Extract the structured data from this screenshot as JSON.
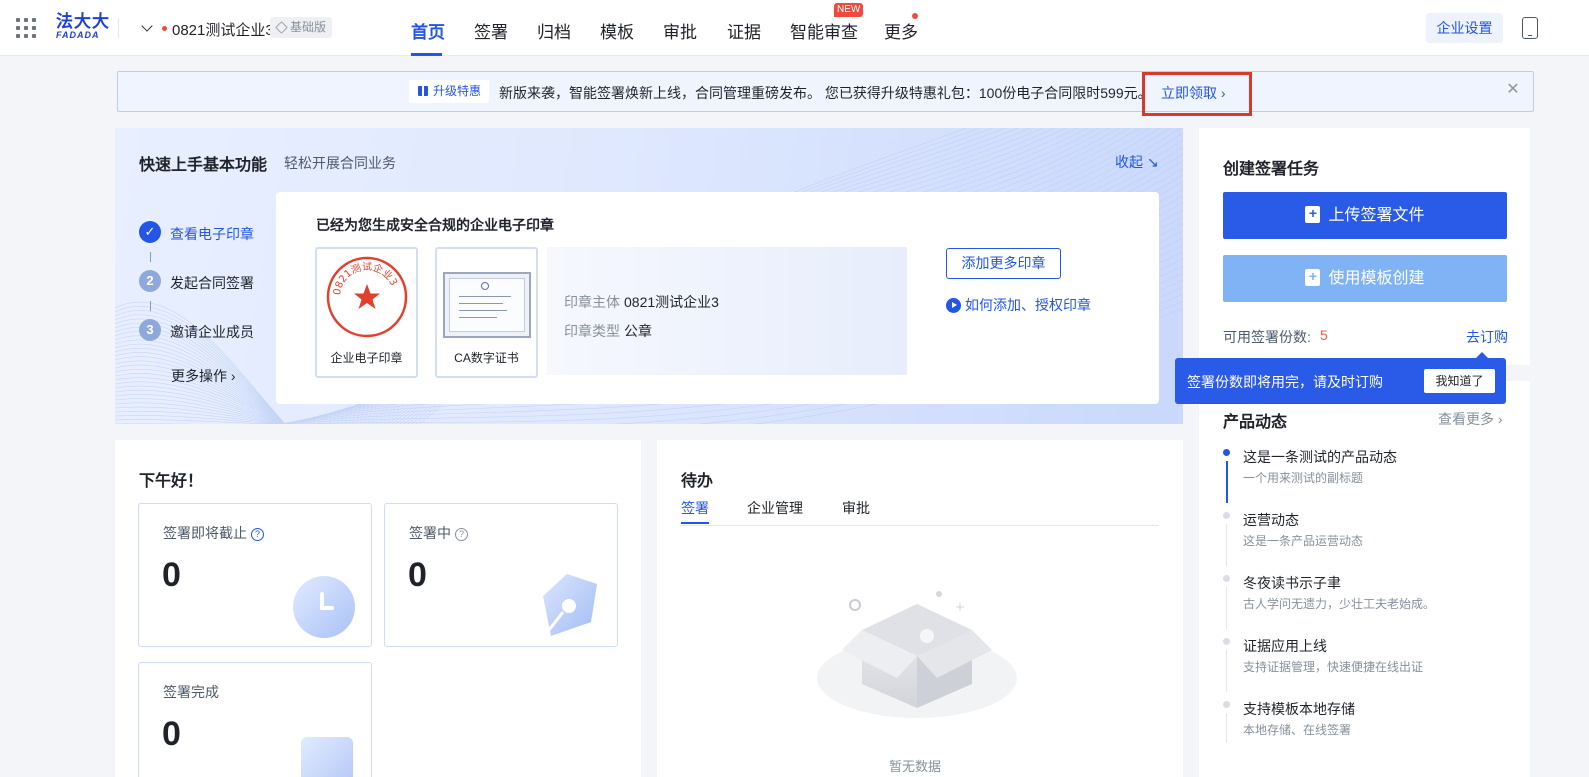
{
  "header": {
    "logo_cn": "法大大",
    "logo_en": "FADADA",
    "company": "0821测试企业3",
    "edition": "基础版",
    "nav": [
      "首页",
      "签署",
      "归档",
      "模板",
      "审批",
      "证据",
      "智能审查",
      "更多"
    ],
    "new_badge": "NEW",
    "settings": "企业设置"
  },
  "banner": {
    "tag": "升级特惠",
    "text": "新版来袭，智能签署焕新上线，合同管理重磅发布。 您已获得升级特惠礼包：100份电子合同限时599元。",
    "claim": "立即领取 ›",
    "close": "✕"
  },
  "quick": {
    "title": "快速上手基本功能",
    "subtitle": "轻松开展合同业务",
    "collapse": "收起 ↘",
    "steps": [
      {
        "num": "✓",
        "label": "查看电子印章"
      },
      {
        "num": "2",
        "label": "发起合同签署"
      },
      {
        "num": "3",
        "label": "邀请企业成员"
      }
    ],
    "more_ops": "更多操作 ›",
    "seal_title": "已经为您生成安全合规的企业电子印章",
    "seal_card_label": "企业电子印章",
    "cert_card_label": "CA数字证书",
    "seal_text": "0821测试企业3",
    "owner_key": "印章主体",
    "owner_val": "0821测试企业3",
    "type_key": "印章类型",
    "type_val": "公章",
    "add_seal": "添加更多印章",
    "howto": "如何添加、授权印章"
  },
  "greeting": {
    "title": "下午好！",
    "stats": [
      {
        "label": "签署即将截止",
        "value": "0"
      },
      {
        "label": "签署中",
        "value": "0"
      },
      {
        "label": "签署完成",
        "value": "0"
      }
    ],
    "help": "?"
  },
  "todo": {
    "title": "待办",
    "tabs": [
      "签署",
      "企业管理",
      "审批"
    ],
    "empty": "暂无数据"
  },
  "create": {
    "title": "创建签署任务",
    "upload": "上传签署文件",
    "template": "使用模板创建",
    "quota_label": "可用签署份数:",
    "quota_val": "5",
    "buy": "去订购",
    "tip": "签署份数即将用完，请及时订购",
    "tip_btn": "我知道了"
  },
  "news": {
    "title": "产品动态",
    "more": "查看更多 ›",
    "items": [
      {
        "h": "这是一条测试的产品动态",
        "s": "一个用来测试的副标题"
      },
      {
        "h": "运营动态",
        "s": "这是一条产品运营动态"
      },
      {
        "h": "冬夜读书示子聿",
        "s": "古人学问无遗力，少壮工夫老始成。"
      },
      {
        "h": "证据应用上线",
        "s": "支持证据管理，快速便捷在线出证"
      },
      {
        "h": "支持模板本地存储",
        "s": "本地存储、在线签署"
      }
    ]
  },
  "colors": {
    "primary": "#2355e6",
    "accent_red": "#f04a3e",
    "highlight_box": "#d73a2a"
  }
}
